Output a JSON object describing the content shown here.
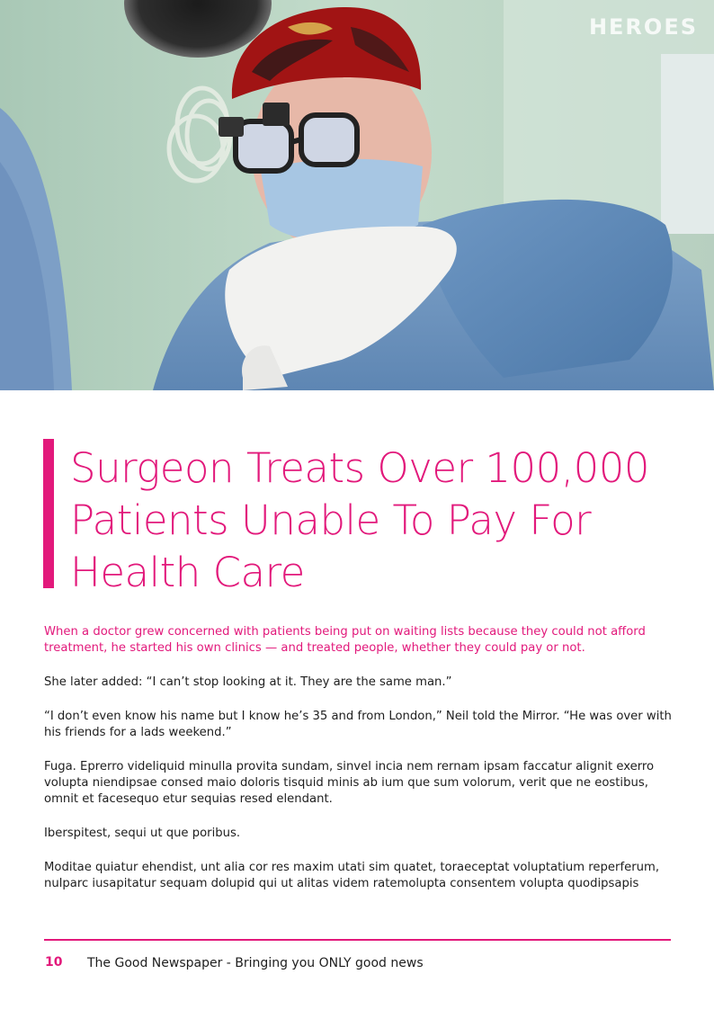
{
  "hero": {
    "watermark": "HEROES"
  },
  "article": {
    "headline": "Surgeon Treats Over 100,000 Patients Unable To Pay For Health Care",
    "lead": "When a doctor grew concerned with patients being put on waiting lists because they could not afford treatment, he started his own clinics — and treated people, whether they could pay or not.",
    "paragraphs": [
      "She later added: “I can’t stop looking at it. They are the same man.”",
      "“I don’t even know his name but I know he’s 35 and from London,” Neil told the Mirror. “He was over with his friends for a lads weekend.”",
      "Fuga. Eprerro videliquid minulla provita sundam, sinvel incia nem rernam ipsam faccatur alignit exerro volupta niendipsae consed maio doloris tisquid minis ab ium que sum volorum, verit que ne eostibus, omnit et facesequo etur sequias resed elendant.",
      "Iberspitest, sequi ut que poribus.",
      "Moditae quiatur ehendist, unt alia cor res maxim utati sim quatet, toraeceptat voluptatium reperferum, nulparc iusapitatur sequam dolupid qui ut alitas videm ratemolupta consentem volupta quodipsapis"
    ]
  },
  "footer": {
    "page_number": "10",
    "text": "The Good Newspaper - Bringing you ONLY good news"
  },
  "colors": {
    "accent": "#e2197b",
    "text": "#1e1e1e"
  }
}
